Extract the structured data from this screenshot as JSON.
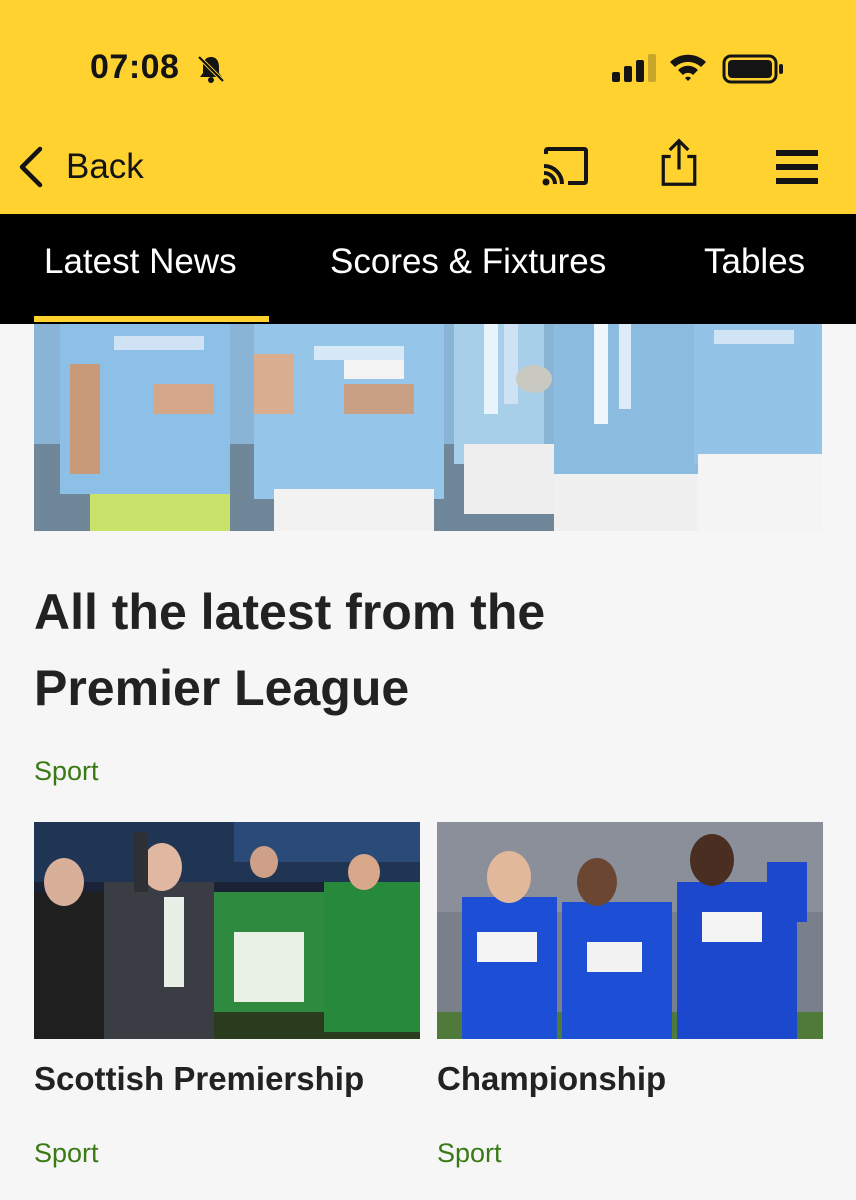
{
  "status_bar": {
    "time": "07:08",
    "icons": [
      "bell-muted-icon",
      "cellular-signal-icon",
      "wifi-icon",
      "battery-icon"
    ]
  },
  "nav": {
    "back_label": "Back",
    "icons": [
      "cast-icon",
      "share-icon",
      "menu-icon"
    ]
  },
  "tabs": [
    {
      "label": "Latest News",
      "active": true
    },
    {
      "label": "Scores & Fixtures",
      "active": false
    },
    {
      "label": "Tables",
      "active": false
    }
  ],
  "hero": {
    "title": "All the latest from the Premier League",
    "category": "Sport"
  },
  "cards": [
    {
      "title": "Scottish Premiership",
      "category": "Sport"
    },
    {
      "title": "Championship",
      "category": "Sport"
    }
  ],
  "colors": {
    "accent": "#ffd230",
    "tab_bar": "#000000",
    "category_green": "#3a7a14",
    "background": "#f6f6f6"
  }
}
